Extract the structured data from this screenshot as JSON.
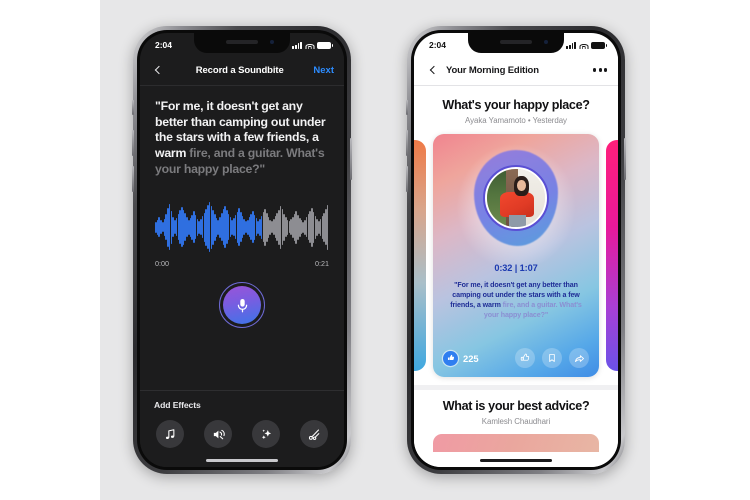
{
  "colors": {
    "backdrop": "#e7e7e8",
    "page": "#ffffff",
    "dark_screen": "#1c1c1d",
    "accent_blue": "#2d8cff",
    "wave_played": "#2f6fe0",
    "wave_unplayed": "#8d8d92",
    "mic_gradient_from": "#9a54d8",
    "mic_gradient_to": "#3d74e8",
    "like_blue": "#2f7ef0",
    "quote_spoken": "#1f2d96",
    "quote_pending": "#8b8fd2"
  },
  "left_phone": {
    "status": {
      "time": "2:04",
      "signal_icon": "cellular-bars-icon",
      "wifi_icon": "wifi-icon",
      "battery_icon": "battery-icon"
    },
    "navbar": {
      "back_icon": "chevron-left-icon",
      "title": "Record a Soundbite",
      "next_label": "Next"
    },
    "transcript": {
      "spoken": "\"For me, it doesn't get any better than camping out under the stars with a few friends, a warm ",
      "pending": "fire, and a guitar. What's your happy place?\""
    },
    "waveform": {
      "start_time": "0:00",
      "end_time": "0:21",
      "played_fraction": 0.62,
      "amplitudes": [
        0.22,
        0.3,
        0.41,
        0.28,
        0.2,
        0.34,
        0.52,
        0.78,
        0.92,
        0.66,
        0.4,
        0.28,
        0.36,
        0.52,
        0.68,
        0.8,
        0.7,
        0.56,
        0.4,
        0.3,
        0.38,
        0.5,
        0.64,
        0.48,
        0.34,
        0.26,
        0.32,
        0.44,
        0.58,
        0.74,
        0.88,
        1.0,
        0.86,
        0.7,
        0.54,
        0.38,
        0.3,
        0.42,
        0.56,
        0.72,
        0.84,
        0.68,
        0.52,
        0.4,
        0.3,
        0.36,
        0.48,
        0.62,
        0.76,
        0.6,
        0.44,
        0.32,
        0.24,
        0.3,
        0.4,
        0.52,
        0.64,
        0.5,
        0.36,
        0.26,
        0.34,
        0.46,
        0.6,
        0.74,
        0.58,
        0.42,
        0.3,
        0.24,
        0.32,
        0.44,
        0.56,
        0.7,
        0.86,
        0.72,
        0.54,
        0.4,
        0.3,
        0.24,
        0.32,
        0.42,
        0.54,
        0.66,
        0.5,
        0.38,
        0.28,
        0.22,
        0.3,
        0.4,
        0.52,
        0.64,
        0.78,
        0.62,
        0.46,
        0.34,
        0.26,
        0.34,
        0.46,
        0.58,
        0.72,
        0.9
      ]
    },
    "record_button": {
      "icon": "microphone-icon",
      "label": "Record"
    },
    "effects": {
      "title": "Add Effects",
      "items": [
        {
          "icon": "music-note-icon",
          "label": "Music"
        },
        {
          "icon": "sound-effects-icon",
          "label": "Sound Effects"
        },
        {
          "icon": "sparkles-icon",
          "label": "Voice Effects"
        },
        {
          "icon": "scissors-icon",
          "label": "Trim"
        }
      ]
    }
  },
  "right_phone": {
    "status": {
      "time": "2:04",
      "signal_icon": "cellular-bars-icon",
      "wifi_icon": "wifi-icon",
      "battery_icon": "battery-icon"
    },
    "navbar": {
      "back_icon": "chevron-left-icon",
      "title": "Your Morning Edition",
      "overflow_icon": "more-options-icon"
    },
    "post": {
      "title": "What's your happy place?",
      "byline": "Ayaka Yamamoto • Yesterday"
    },
    "card": {
      "time_display": "0:32 | 1:07",
      "quote_spoken": "\"For me, it doesn't get any better than camping out under the stars with a few friends, a warm ",
      "quote_pending": "fire, and a guitar. What's your happy place?\"",
      "like_count": "225",
      "like_badge_icon": "thumbs-up-filled-icon",
      "actions": [
        {
          "icon": "thumbs-up-icon",
          "label": "Like"
        },
        {
          "icon": "bookmark-icon",
          "label": "Save"
        },
        {
          "icon": "share-icon",
          "label": "Share"
        }
      ],
      "avatar_icon": "user-photo"
    },
    "next_post": {
      "title": "What is your best advice?",
      "byline": "Kamlesh Chaudhari"
    }
  }
}
